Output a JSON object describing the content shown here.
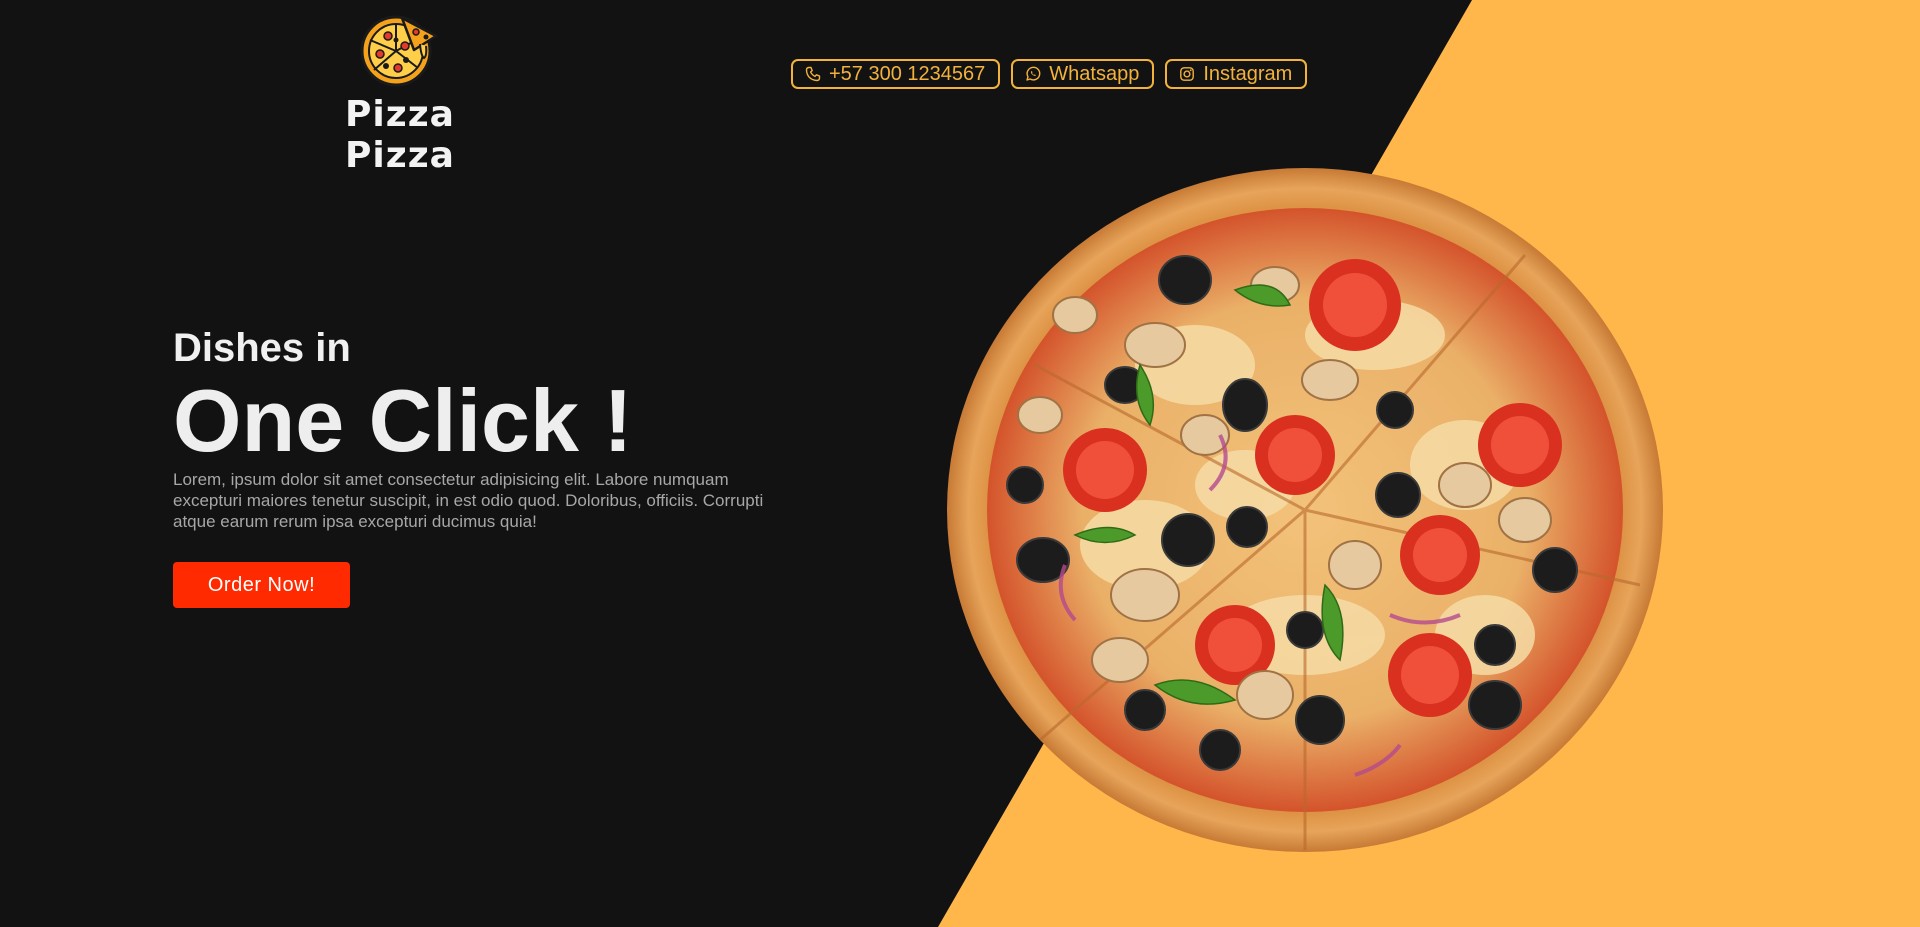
{
  "brand": {
    "name": "Pizza Pizza",
    "logo_icon": "pizza-logo-icon"
  },
  "header": {
    "contacts": [
      {
        "icon": "phone-icon",
        "label": "+57 300 1234567"
      },
      {
        "icon": "whatsapp-icon",
        "label": "Whatsapp"
      },
      {
        "icon": "instagram-icon",
        "label": "Instagram"
      }
    ]
  },
  "hero": {
    "subtitle": "Dishes in",
    "title": "One Click !",
    "description": "Lorem, ipsum dolor sit amet consectetur adipisicing elit. Labore numquam excepturi maiores tenetur suscipit, in est odio quod. Doloribus, officiis. Corrupti atque earum rerum ipsa excepturi ducimus quia!",
    "cta_label": "Order Now!"
  },
  "colors": {
    "background": "#121213",
    "accent_orange": "#ffb64a",
    "outline_gold": "#f2b23c",
    "cta_red": "#ff2a00"
  }
}
